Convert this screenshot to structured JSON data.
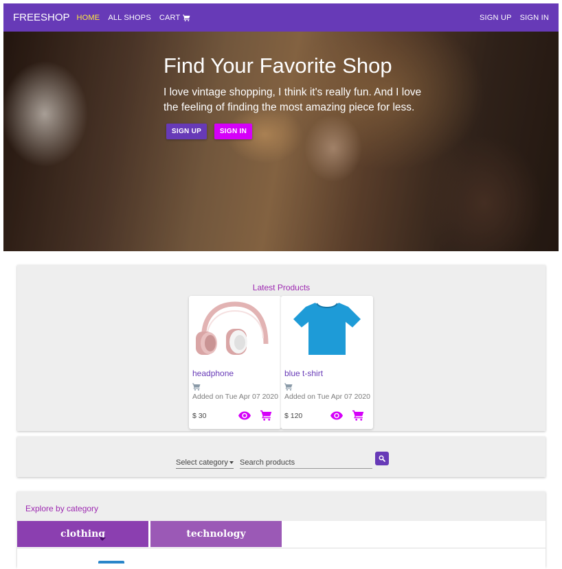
{
  "navbar": {
    "brand": "FREESHOP",
    "links": [
      "HOME",
      "ALL SHOPS",
      "CART"
    ],
    "right_links": [
      "SIGN UP",
      "SIGN IN"
    ],
    "bg_color": "#673ab7",
    "active_color": "#ffeb3b"
  },
  "hero": {
    "title": "Find Your Favorite Shop",
    "text": "I love vintage shopping, I think it's really fun. And I love the feeling of finding the most amazing piece for less.",
    "signup_label": "SIGN UP",
    "signin_label": "SIGN IN"
  },
  "latest": {
    "title": "Latest Products",
    "products": [
      {
        "name": "headphone",
        "date": "Added on Tue Apr 07 2020",
        "price": "$ 30",
        "image": "headphone-image"
      },
      {
        "name": "blue t-shirt",
        "date": "Added on Tue Apr 07 2020",
        "price": "$ 120",
        "image": "tshirt-image"
      }
    ]
  },
  "search": {
    "category_label": "Select category",
    "placeholder": "Search products"
  },
  "explore": {
    "title": "Explore by category",
    "tabs": [
      "clothing",
      "technology"
    ]
  },
  "colors": {
    "primary": "#673ab7",
    "accent": "#d500f9",
    "heading": "#9c27b0"
  }
}
